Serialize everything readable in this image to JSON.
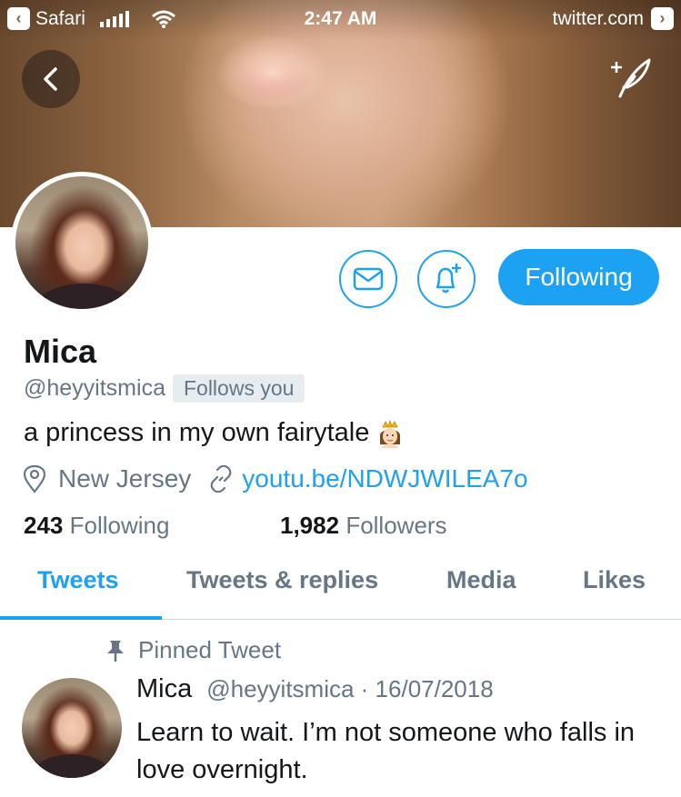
{
  "status_bar": {
    "back_app": "Safari",
    "time": "2:47 AM",
    "domain": "twitter.com"
  },
  "profile": {
    "name": "Mica",
    "handle": "@heyyitsmica",
    "follows_you": "Follows you",
    "bio": "a princess in my own fairytale",
    "bio_emoji": "princess-emoji",
    "location": "New Jersey",
    "link": "youtu.be/NDWJWILEA7o",
    "following_count": "243",
    "following_label": "Following",
    "followers_count": "1,982",
    "followers_label": "Followers"
  },
  "actions": {
    "following_button": "Following"
  },
  "tabs": [
    {
      "label": "Tweets",
      "active": true
    },
    {
      "label": "Tweets & replies",
      "active": false
    },
    {
      "label": "Media",
      "active": false
    },
    {
      "label": "Likes",
      "active": false
    }
  ],
  "pinned_tweet": {
    "pinned_label": "Pinned Tweet",
    "author": "Mica",
    "handle_date": "@heyyitsmica · 16/07/2018",
    "text": "Learn to wait. I’m not someone who falls in love overnight."
  },
  "colors": {
    "accent": "#1da1f2",
    "secondary_text": "#657786",
    "primary_text": "#14171a",
    "badge_bg": "#e6ecf0"
  }
}
